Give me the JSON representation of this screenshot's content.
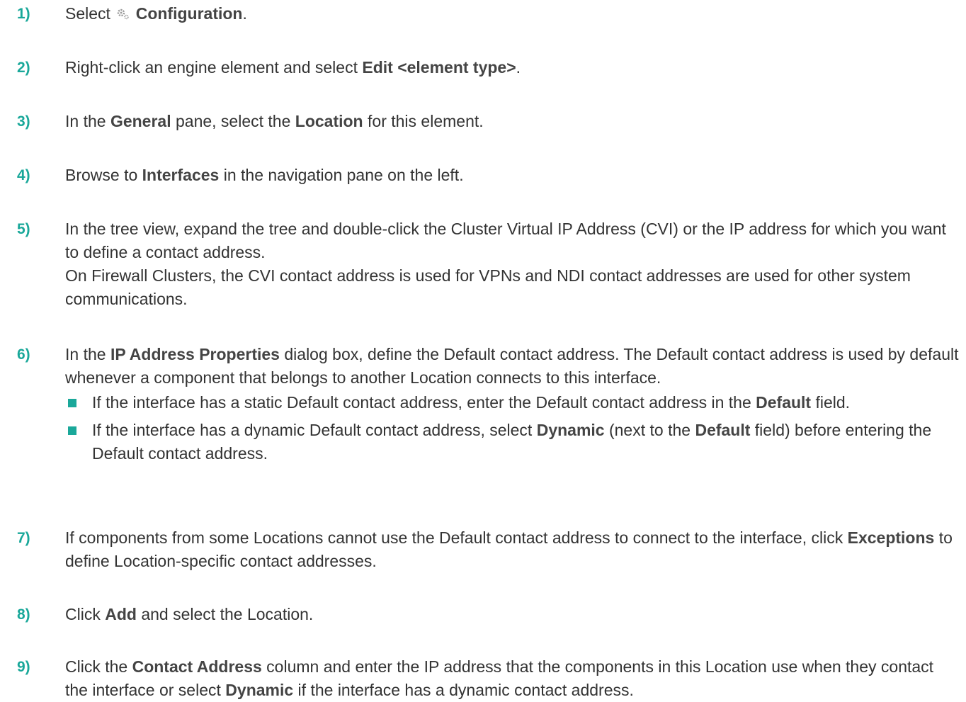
{
  "steps": [
    {
      "number": "1)",
      "segments": [
        {
          "t": "Select ",
          "b": false
        },
        {
          "icon": "gear-icon"
        },
        {
          "t": " Configuration",
          "b": true
        },
        {
          "t": ".",
          "b": false
        }
      ]
    },
    {
      "number": "2)",
      "segments": [
        {
          "t": "Right-click an engine element and select ",
          "b": false
        },
        {
          "t": "Edit <element type>",
          "b": true
        },
        {
          "t": ".",
          "b": false
        }
      ]
    },
    {
      "number": "3)",
      "segments": [
        {
          "t": "In the ",
          "b": false
        },
        {
          "t": "General",
          "b": true
        },
        {
          "t": " pane, select the ",
          "b": false
        },
        {
          "t": "Location",
          "b": true
        },
        {
          "t": " for this element.",
          "b": false
        }
      ]
    },
    {
      "number": "4)",
      "segments": [
        {
          "t": "Browse to ",
          "b": false
        },
        {
          "t": "Interfaces",
          "b": true
        },
        {
          "t": " in the navigation pane on the left.",
          "b": false
        }
      ]
    },
    {
      "number": "5)",
      "segments": [
        {
          "t": "In the tree view, expand the tree and double-click the Cluster Virtual IP Address (CVI) or the IP address for which you want to define a contact address.",
          "b": false
        }
      ],
      "note": "On Firewall Clusters, the CVI contact address is used for VPNs and NDI contact addresses are used for other system communications."
    },
    {
      "number": "6)",
      "segments": [
        {
          "t": "In the ",
          "b": false
        },
        {
          "t": "IP Address Properties",
          "b": true
        },
        {
          "t": " dialog box, define the Default contact address. The Default contact address is used by default whenever a component that belongs to another Location connects to this interface.",
          "b": false
        }
      ],
      "bullets": [
        [
          {
            "t": "If the interface has a static Default contact address, enter the Default contact address in the ",
            "b": false
          },
          {
            "t": "Default",
            "b": true
          },
          {
            "t": " field.",
            "b": false
          }
        ],
        [
          {
            "t": "If the interface has a dynamic Default contact address, select ",
            "b": false
          },
          {
            "t": "Dynamic",
            "b": true
          },
          {
            "t": " (next to the ",
            "b": false
          },
          {
            "t": "Default",
            "b": true
          },
          {
            "t": " field) before entering the Default contact address.",
            "b": false
          }
        ]
      ]
    },
    {
      "number": "7)",
      "segments": [
        {
          "t": "If components from some Locations cannot use the Default contact address to connect to the interface, click ",
          "b": false
        },
        {
          "t": "Exceptions",
          "b": true
        },
        {
          "t": " to define Location-specific contact addresses.",
          "b": false
        }
      ]
    },
    {
      "number": "8)",
      "segments": [
        {
          "t": "Click ",
          "b": false
        },
        {
          "t": "Add",
          "b": true
        },
        {
          "t": " and select the Location.",
          "b": false
        }
      ]
    },
    {
      "number": "9)",
      "segments": [
        {
          "t": "Click the ",
          "b": false
        },
        {
          "t": "Contact Address",
          "b": true
        },
        {
          "t": " column and enter the IP address that the components in this Location use when they contact the interface or select ",
          "b": false
        },
        {
          "t": "Dynamic",
          "b": true
        },
        {
          "t": " if the interface has a dynamic contact address.",
          "b": false
        }
      ]
    }
  ],
  "colors": {
    "accent": "#1aa89a",
    "text": "#333333",
    "icon": "#9a9a9a"
  }
}
